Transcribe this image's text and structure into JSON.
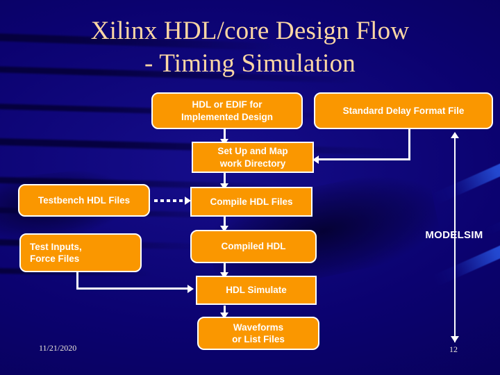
{
  "slide": {
    "title": "Xilinx HDL/core Design Flow\n- Timing Simulation",
    "date": "11/21/2020",
    "page_number": "12",
    "side_label": "MODELSIM",
    "colors": {
      "background": "#0a0070",
      "box_fill": "#fa9700",
      "box_border": "#ffffff",
      "box_text": "#ffffff",
      "title_text": "#fcd7a4",
      "connector": "#ffffff",
      "footer_text": "#e9e4d8"
    }
  },
  "boxes": {
    "hdl_edif": "HDL or EDIF for\nImplemented Design",
    "sdf": "Standard Delay Format File",
    "setup_map": "Set Up and Map\nwork Directory",
    "testbench": "Testbench HDL Files",
    "compile": "Compile HDL Files",
    "test_inputs": "Test Inputs,\nForce Files",
    "compiled_hdl": "Compiled HDL",
    "hdl_simulate": "HDL Simulate",
    "waveforms": "Waveforms\nor List Files"
  }
}
